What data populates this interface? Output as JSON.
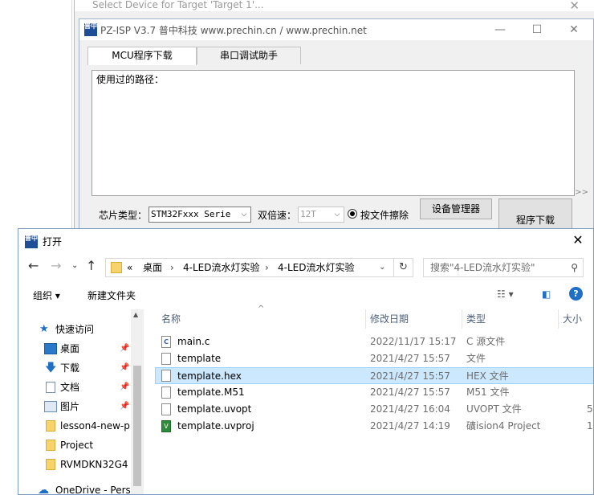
{
  "background_window": {
    "title": "Select Device for Target 'Target 1'..."
  },
  "isp": {
    "title": "PZ-ISP V3.7  普中科技  www.prechin.cn / www.prechin.net",
    "tabs": [
      "MCU程序下载",
      "串口调试助手"
    ],
    "textarea_label": "使用过的路径：",
    "chip_label": "芯片类型：",
    "chip_value": "STM32Fxxx Serie",
    "speed_label": "双倍速：",
    "speed_value": "12T",
    "erase_label": "按文件擦除",
    "device_manager_btn": "设备管理器",
    "program_btn": "程序下载"
  },
  "dialog": {
    "title": "打开",
    "breadcrumb": [
      "«",
      "桌面",
      "4-LED流水灯实验",
      "4-LED流水灯实验"
    ],
    "search_placeholder": "搜索\"4-LED流水灯实验\"",
    "organize": "组织 ▾",
    "new_folder": "新建文件夹",
    "nav": [
      {
        "label": "快速访问",
        "icon": "star-icon"
      },
      {
        "label": "桌面",
        "icon": "desktop-icon",
        "pinned": true
      },
      {
        "label": "下载",
        "icon": "download-icon",
        "pinned": true
      },
      {
        "label": "文档",
        "icon": "document-icon",
        "pinned": true
      },
      {
        "label": "图片",
        "icon": "picture-icon",
        "pinned": true
      },
      {
        "label": "lesson4-new-p",
        "icon": "folder-icon"
      },
      {
        "label": "Project",
        "icon": "folder-icon"
      },
      {
        "label": "RVMDKN32G4",
        "icon": "folder-icon"
      },
      {
        "label": "OneDrive - Perso",
        "icon": "cloud-icon"
      }
    ],
    "columns": [
      "名称",
      "修改日期",
      "类型",
      "大小"
    ],
    "files": [
      {
        "name": "main.c",
        "date": "2022/11/17 15:17",
        "type": "C 源文件",
        "size": "",
        "icon": "c-file-icon"
      },
      {
        "name": "template",
        "date": "2021/4/27 15:57",
        "type": "文件",
        "size": "",
        "icon": "file-icon"
      },
      {
        "name": "template.hex",
        "date": "2021/4/27 15:57",
        "type": "HEX 文件",
        "size": "",
        "icon": "file-icon",
        "selected": true
      },
      {
        "name": "template.M51",
        "date": "2021/4/27 15:57",
        "type": "M51 文件",
        "size": "",
        "icon": "file-icon"
      },
      {
        "name": "template.uvopt",
        "date": "2021/4/27 16:04",
        "type": "UVOPT 文件",
        "size": "5",
        "icon": "file-icon"
      },
      {
        "name": "template.uvproj",
        "date": "2021/4/27 14:19",
        "type": "礦ision4 Project",
        "size": "1",
        "icon": "uvision-icon"
      }
    ]
  },
  "colors": {
    "selection": "#cce8ff",
    "selection_border": "#99d1ff",
    "help": "#1f6fc6",
    "folder": "#f6d36b"
  }
}
